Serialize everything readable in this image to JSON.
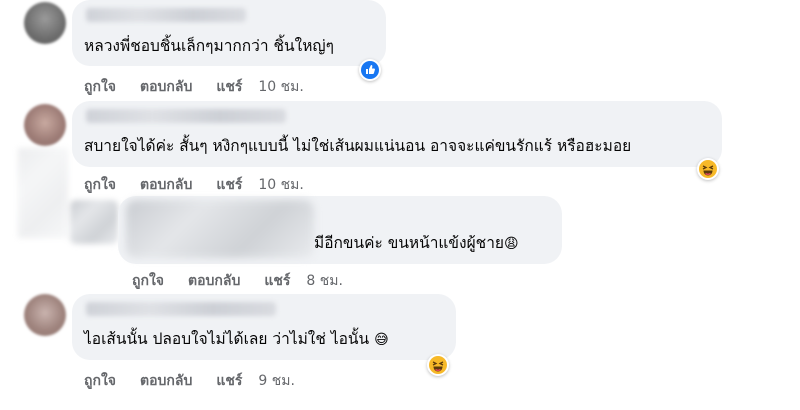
{
  "comments": [
    {
      "text": "หลวงพี่ชอบชิ้นเล็กๆมากกว่า ชิ้นใหญ่ๆ",
      "reaction": "like-icon",
      "actions": {
        "like": "ถูกใจ",
        "reply": "ตอบกลับ",
        "share": "แชร์",
        "time": "10 ชม."
      }
    },
    {
      "text": "สบายใจได้ค่ะ สั้นๆ หงิกๆแบบนี้ ไม่ใช่เส้นผมแน่นอน อาจจะแค่ขนรักแร้ หรือฮะมอย",
      "reaction": "haha-icon",
      "actions": {
        "like": "ถูกใจ",
        "reply": "ตอบกลับ",
        "share": "แชร์",
        "time": "10 ชม."
      }
    },
    {
      "text": "มีอีกขนค่ะ ขนหน้าแข้งผู้ชาย",
      "emoji": "😩",
      "actions": {
        "like": "ถูกใจ",
        "reply": "ตอบกลับ",
        "share": "แชร์",
        "time": "8 ชม."
      }
    },
    {
      "text": "ไอเส้นนั้น ปลอบใจไม่ได้เลย ว่าไม่ใช่ ไอนั้น",
      "emoji": "😅",
      "reaction": "haha-icon",
      "actions": {
        "like": "ถูกใจ",
        "reply": "ตอบกลับ",
        "share": "แชร์",
        "time": "9 ชม."
      }
    }
  ],
  "colors": {
    "bubble": "#f0f2f5",
    "action_text": "#65676b",
    "like_blue": "#1877f2",
    "haha_yellow": "#f7b928"
  }
}
